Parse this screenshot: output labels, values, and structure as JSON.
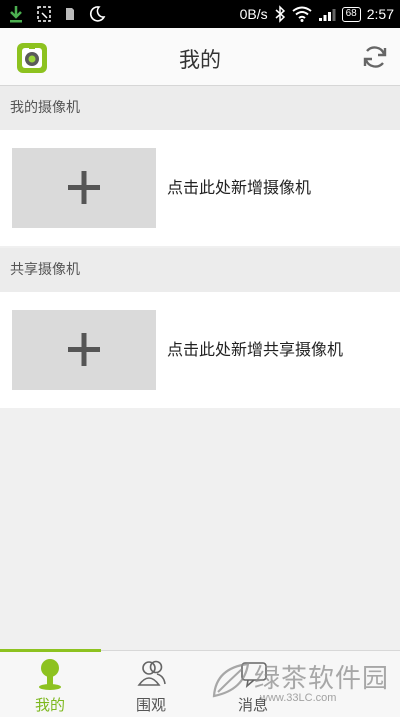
{
  "status_bar": {
    "network_speed": "0B/s",
    "battery": "68",
    "time": "2:57",
    "left_icons": [
      "download-icon",
      "screenshot-icon",
      "sim-icon",
      "moon-icon"
    ],
    "right_icons": [
      "bluetooth-icon",
      "wifi-icon",
      "signal-icon",
      "battery-icon"
    ]
  },
  "header": {
    "title": "我的",
    "logo_icon": "camera-app-logo-icon",
    "refresh_icon": "refresh-icon",
    "brand_color": "#8dc21f"
  },
  "sections": [
    {
      "header": "我的摄像机",
      "add_label": "点击此处新增摄像机",
      "add_icon": "plus-icon"
    },
    {
      "header": "共享摄像机",
      "add_label": "点击此处新增共享摄像机",
      "add_icon": "plus-icon"
    }
  ],
  "tabs": [
    {
      "label": "我的",
      "icon": "person-icon",
      "active": true
    },
    {
      "label": "围观",
      "icon": "people-icon",
      "active": false
    },
    {
      "label": "消息",
      "icon": "message-icon",
      "active": false
    }
  ],
  "watermark": {
    "text": "绿茶软件园",
    "url": "www.33LC.com"
  }
}
